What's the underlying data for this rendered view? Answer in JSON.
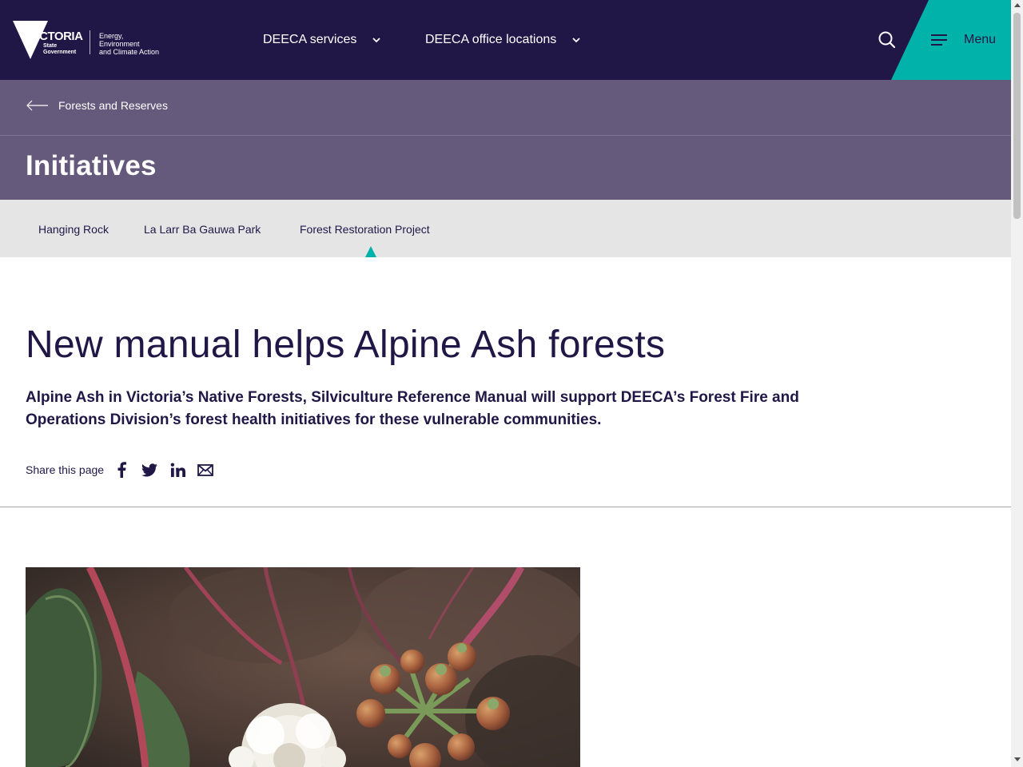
{
  "header": {
    "logo": {
      "brand": "VICTORIA",
      "brand_sub_line1": "State",
      "brand_sub_line2": "Government",
      "dept_line1": "Energy,",
      "dept_line2": "Environment",
      "dept_line3": "and Climate Action"
    },
    "nav": [
      {
        "label": "DEECA services"
      },
      {
        "label": "DEECA office locations"
      }
    ],
    "menu_label": "Menu",
    "colors": {
      "bar": "#201747",
      "accent": "#00b2a9"
    }
  },
  "banner": {
    "breadcrumb": "Forests and Reserves",
    "title": "Initiatives",
    "color": "#655a7c"
  },
  "subnav": {
    "items": [
      {
        "label": "Hanging Rock"
      },
      {
        "label": "La Larr Ba Gauwa Park"
      },
      {
        "label": "Forest Restoration Project"
      }
    ],
    "active": "Forest Restoration Project"
  },
  "article": {
    "headline": "New manual helps Alpine Ash forests",
    "lede": "Alpine Ash in Victoria’s Native Forests, Silviculture Reference Manual will support DEECA’s Forest Fire and Operations Division’s forest health initiatives for these vulnerable communities.",
    "share_label": "Share this page",
    "share_icons": [
      "facebook-icon",
      "twitter-icon",
      "linkedin-icon",
      "email-icon"
    ]
  }
}
